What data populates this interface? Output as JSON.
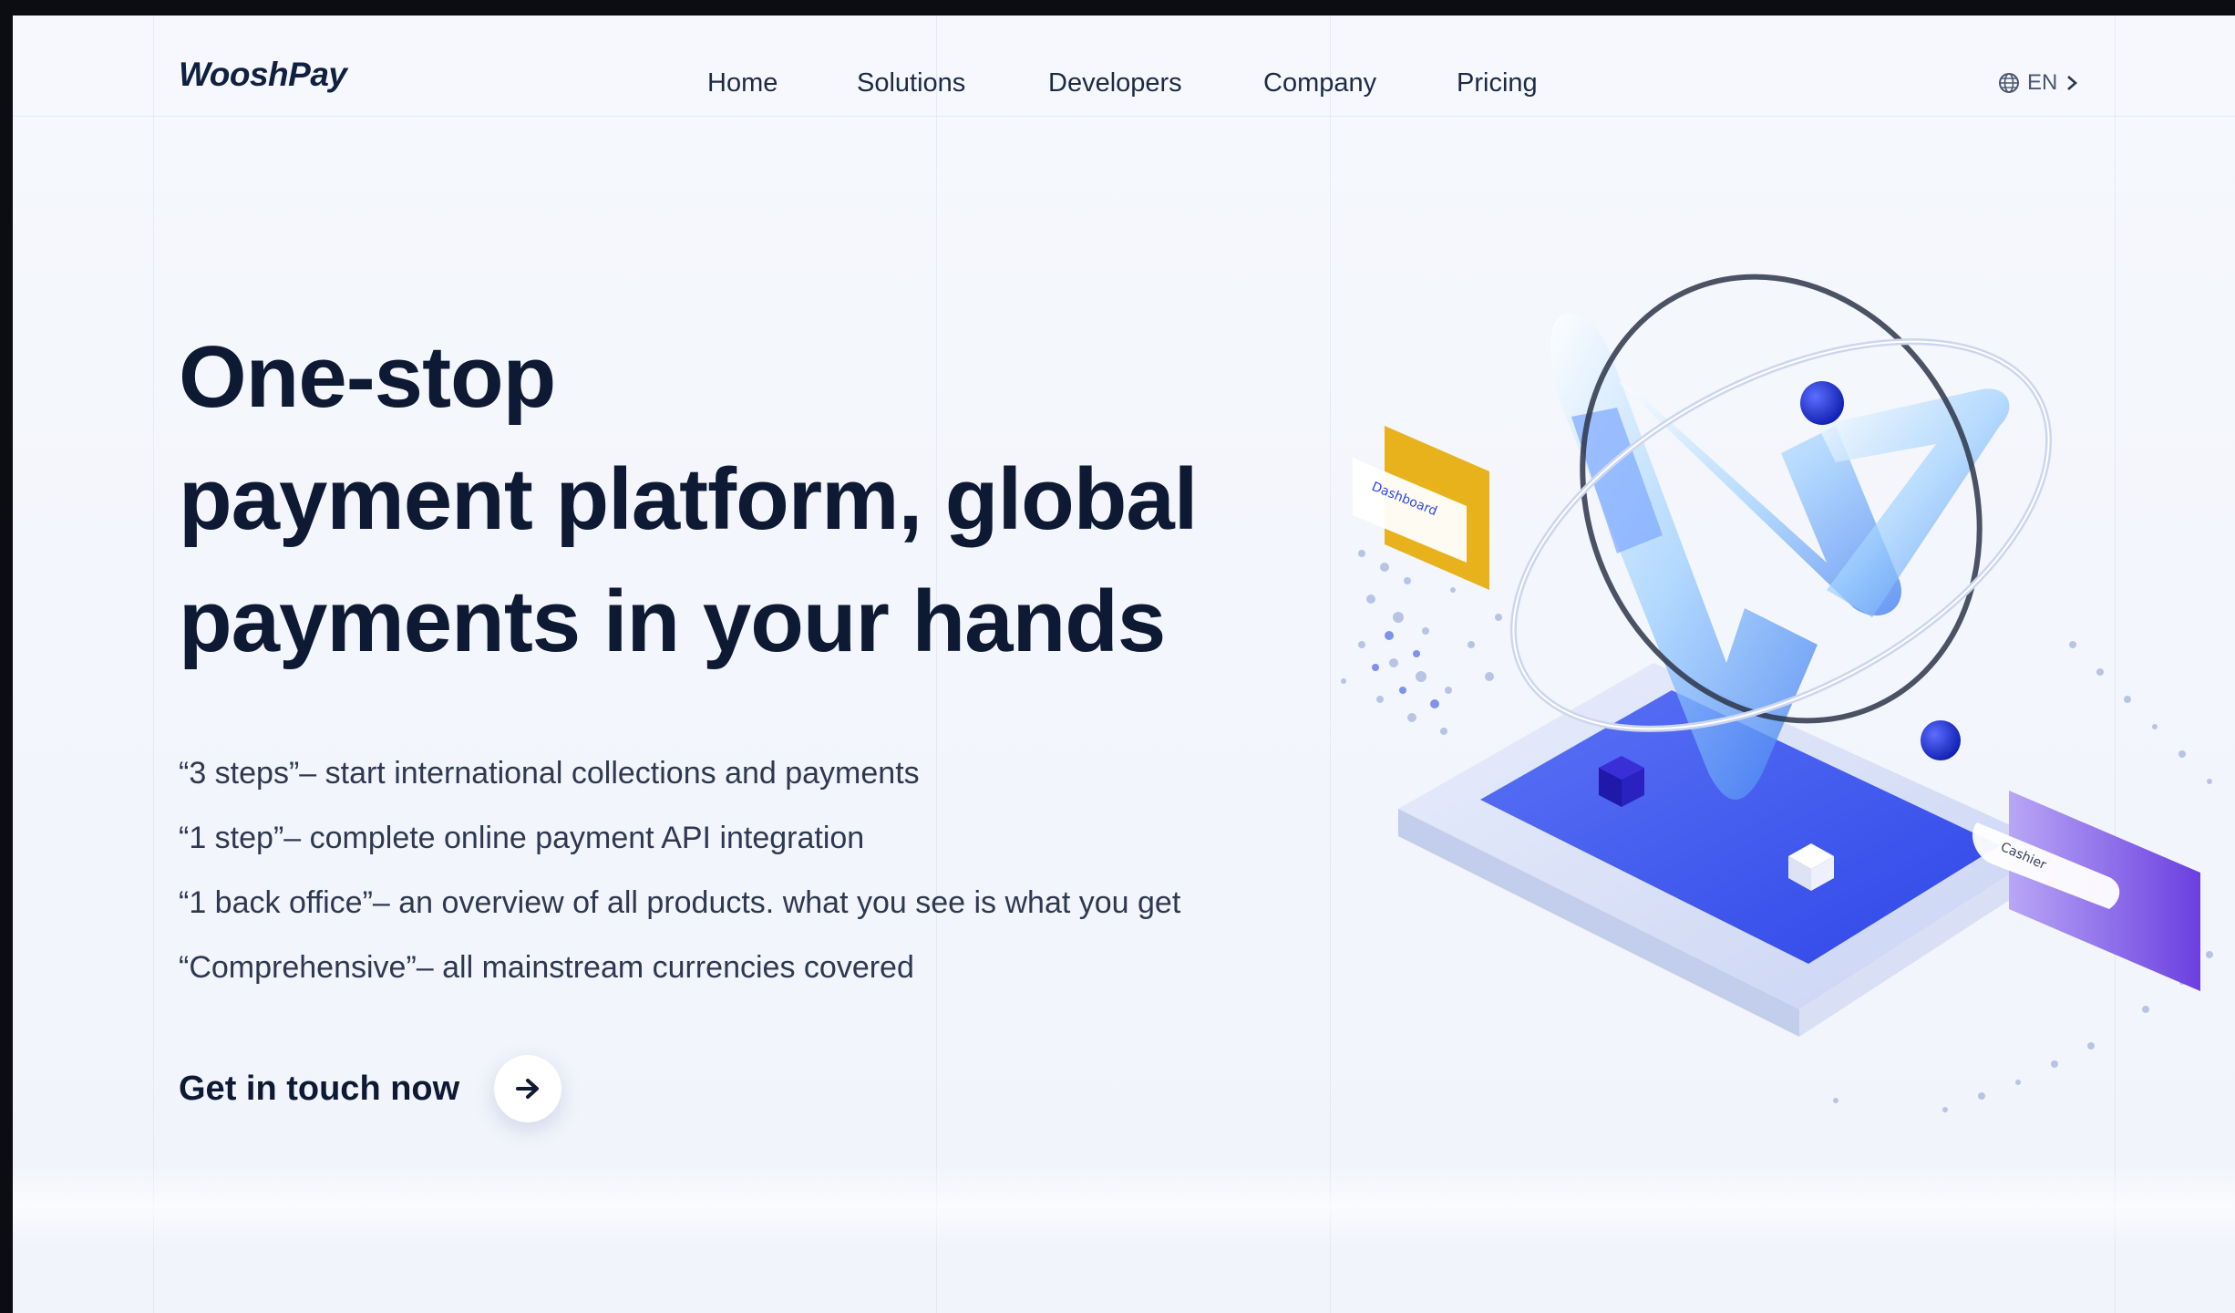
{
  "brand": {
    "logo_text": "WooshPay"
  },
  "nav": {
    "items": [
      {
        "label": "Home"
      },
      {
        "label": "Solutions"
      },
      {
        "label": "Developers"
      },
      {
        "label": "Company"
      },
      {
        "label": "Pricing"
      }
    ],
    "language": {
      "label": "EN",
      "icon": "globe-icon",
      "chevron": "chevron-right-icon"
    }
  },
  "hero": {
    "title_lines": [
      "One-stop",
      "payment platform, global",
      "payments in your hands"
    ],
    "features": [
      "“3 steps”– start international collections and payments",
      "“1 step”– complete online payment API integration",
      "“1 back office”– an overview of all products. what you see is what you get",
      "“Comprehensive”– all mainstream currencies covered"
    ],
    "cta": {
      "label": "Get in touch now",
      "icon": "arrow-right-icon"
    }
  },
  "illustration": {
    "card_left_label": "Dashboard",
    "card_right_label": "Cashier"
  },
  "colors": {
    "background": "#f4f7fc",
    "text_dark": "#0e1a33",
    "accent_blue": "#2f46e8",
    "accent_purple": "#7a4ae6",
    "accent_gold": "#e8b21c"
  }
}
